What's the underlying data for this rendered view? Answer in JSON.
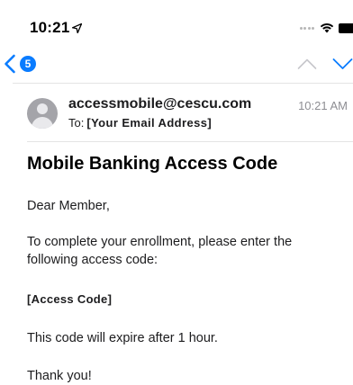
{
  "status_bar": {
    "time": "10:21",
    "location_icon": "location-arrow-icon",
    "signal_icon": "signal-dots-icon",
    "wifi_icon": "wifi-icon",
    "battery_icon": "battery-icon"
  },
  "nav": {
    "back_icon": "chevron-left-icon",
    "unread_count": "5",
    "prev_icon": "chevron-up-icon",
    "next_icon": "chevron-down-icon",
    "accent_color": "#0a7cff"
  },
  "email": {
    "sender": "accessmobile@cescu.com",
    "recipient_prefix": "To:",
    "recipient": "[Your Email Address]",
    "time": "10:21 AM",
    "subject": "Mobile Banking Access Code",
    "body": {
      "greeting": "Dear Member,",
      "instructions": "To complete your enrollment, please enter the following access code:",
      "access_code": "[Access Code]",
      "expiry": "This code will expire after 1 hour.",
      "closing": "Thank you!"
    }
  }
}
